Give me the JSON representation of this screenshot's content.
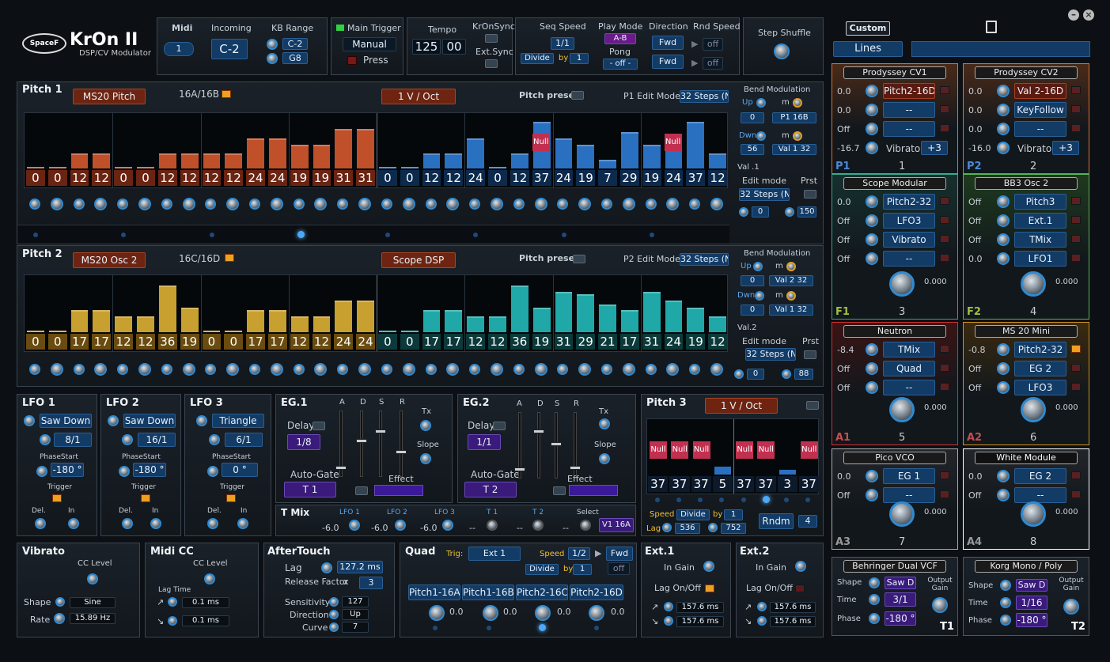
{
  "header": {
    "logo": "KrOn II",
    "logo_brand": "SpaceF",
    "subtitle": "DSP/CV Modulator",
    "midi_label": "Midi",
    "midi_value": "1",
    "incoming_label": "Incoming",
    "incoming_value": "C-2",
    "kb_range_label": "KB Range",
    "kb_low": "C-2",
    "kb_high": "G8",
    "main_trigger_label": "Main Trigger",
    "main_trigger_value": "Manual",
    "press_label": "Press",
    "tempo_label": "Tempo",
    "tempo_int": "125",
    "tempo_frac": "00",
    "kronsync_label": "KrOnSync",
    "extsync_label": "Ext.Sync",
    "seq_speed_label": "Seq Speed",
    "seq_speed_value": "1/1",
    "divide_label": "Divide",
    "by_label": "by",
    "by_value": "1",
    "play_mode_label": "Play Mode",
    "play_mode_value": "A-B",
    "pong_label": "Pong",
    "pong_value": "- off -",
    "direction_label": "Direction",
    "direction_value1": "Fwd",
    "direction_value2": "Fwd",
    "rnd_speed_label": "Rnd Speed",
    "rnd_value1": "off",
    "rnd_value2": "off",
    "step_shuffle_label": "Step Shuffle"
  },
  "pitch1": {
    "title": "Pitch 1",
    "source": "MS20 Pitch",
    "steps_label": "16A/16B",
    "mode": "1 V / Oct",
    "presets_label": "Pitch presets",
    "edit_mode_label": "P1 Edit Mode",
    "edit_mode_value": "32 Steps (N",
    "values": [
      "0",
      "0",
      "12",
      "12",
      "0",
      "0",
      "12",
      "12",
      "12",
      "12",
      "24",
      "24",
      "19",
      "19",
      "31",
      "31",
      "0",
      "0",
      "12",
      "12",
      "24",
      "0",
      "12",
      "37",
      "24",
      "19",
      "7",
      "29",
      "19",
      "24",
      "37",
      "12"
    ],
    "bend_label": "Bend Modulation",
    "up_label": "Up",
    "m_label": "m",
    "up_value": "0",
    "up_target": "P1 16B",
    "dwn_label": "Dwn",
    "dwn_value": "56",
    "dwn_target": "Val 1 32",
    "val_label": "Val .1",
    "edit_label": "Edit mode",
    "edit_value": "32 Steps (N",
    "prst_label": "Prst",
    "v_a": "0",
    "v_b": "150"
  },
  "pitch2": {
    "title": "Pitch 2",
    "source": "MS20 Osc 2",
    "steps_label": "16C/16D",
    "mode": "Scope DSP",
    "presets_label": "Pitch presets",
    "edit_mode_label": "P2 Edit Mode",
    "edit_mode_value": "32 Steps (N",
    "values": [
      "0",
      "0",
      "17",
      "17",
      "12",
      "12",
      "36",
      "19",
      "0",
      "0",
      "17",
      "17",
      "12",
      "12",
      "24",
      "24",
      "0",
      "0",
      "17",
      "17",
      "12",
      "12",
      "36",
      "19",
      "31",
      "29",
      "21",
      "17",
      "31",
      "24",
      "19",
      "12"
    ],
    "bend_label": "Bend Modulation",
    "up_label": "Up",
    "m_label": "m",
    "up_value": "0",
    "up_target": "Val 2 32",
    "dwn_label": "Dwn",
    "dwn_value": "0",
    "dwn_target": "Val 1 32",
    "val_label": "Val.2",
    "edit_label": "Edit mode",
    "edit_value": "32 Steps (N",
    "prst_label": "Prst",
    "v_a": "0",
    "v_b": "88"
  },
  "lfos": [
    {
      "title": "LFO 1",
      "wave": "Saw Down",
      "rate": "8/1",
      "phase_label": "PhaseStart",
      "phase": "-180 °",
      "trigger": "Trigger",
      "del": "Del.",
      "in": "In"
    },
    {
      "title": "LFO 2",
      "wave": "Saw Down",
      "rate": "16/1",
      "phase_label": "PhaseStart",
      "phase": "-180 °",
      "trigger": "Trigger",
      "del": "Del.",
      "in": "In"
    },
    {
      "title": "LFO 3",
      "wave": "Triangle",
      "rate": "6/1",
      "phase_label": "PhaseStart",
      "phase": "0 °",
      "trigger": "Trigger",
      "del": "Del.",
      "in": "In"
    }
  ],
  "egs": [
    {
      "title": "EG.1",
      "delay_label": "Delay",
      "delay": "1/8",
      "autogate": "Auto-Gate",
      "gate": "T 1",
      "effect": "Effect",
      "tx": "Tx",
      "slope": "Slope"
    },
    {
      "title": "EG.2",
      "delay_label": "Delay",
      "delay": "1/1",
      "autogate": "Auto-Gate",
      "gate": "T 2",
      "effect": "Effect",
      "tx": "Tx",
      "slope": "Slope"
    }
  ],
  "adsr": [
    "A",
    "D",
    "S",
    "R"
  ],
  "tmix": {
    "title": "T Mix",
    "labels": [
      "LFO 1",
      "LFO 2",
      "LFO 3",
      "T 1",
      "T 2",
      "Select"
    ],
    "values": [
      "-6.0",
      "-6.0",
      "-6.0",
      "--",
      "--",
      "--"
    ],
    "select": "V1 16A"
  },
  "pitch3": {
    "title": "Pitch 3",
    "mode": "1 V / Oct",
    "values": [
      "37",
      "37",
      "37",
      "5",
      "37",
      "37",
      "3",
      "37"
    ],
    "null": "Null",
    "speed_label": "Speed",
    "divide": "Divide",
    "by": "by",
    "by_value": "1",
    "lag_label": "Lag",
    "lag1": "536",
    "lag2": "752",
    "rndm": "Rndm",
    "rndm_value": "4"
  },
  "vibrato": {
    "title": "Vibrato",
    "cc_label": "CC Level",
    "shape_label": "Shape",
    "shape": "Sine",
    "rate_label": "Rate",
    "rate": "15.89 Hz"
  },
  "midicc": {
    "title": "Midi CC",
    "cc_label": "CC Level",
    "lag_label": "Lag Time",
    "lag1": "0.1 ms",
    "lag2": "0.1 ms"
  },
  "aftertouch": {
    "title": "AfterTouch",
    "lag_label": "Lag",
    "lag": "127.2 ms",
    "release_label": "Release Factor",
    "x_label": "x",
    "release": "3",
    "sens_label": "Sensitivity",
    "sens": "127",
    "dir_label": "Direction",
    "dir": "Up",
    "curve_label": "Curve",
    "curve": "7"
  },
  "quad": {
    "title": "Quad",
    "trig_label": "Trig:",
    "trig": "Ext 1",
    "speed_label": "Speed",
    "speed": "1/2",
    "dir": "Fwd",
    "divide": "Divide",
    "by": "by",
    "by_value": "1",
    "off": "off",
    "outs": [
      "Pitch1-16A",
      "Pitch1-16B",
      "Pitch2-16C",
      "Pitch2-16D"
    ],
    "vals": [
      "0.0",
      "0.0",
      "0.0",
      "0.0"
    ]
  },
  "ext1": {
    "title": "Ext.1",
    "gain": "In Gain",
    "lag": "Lag On/Off",
    "v1": "157.6 ms",
    "v2": "157.6 ms"
  },
  "ext2": {
    "title": "Ext.2",
    "gain": "In Gain",
    "lag": "Lag On/Off",
    "v1": "157.6 ms",
    "v2": "157.6 ms"
  },
  "right": {
    "custom": "Custom",
    "lines": "Lines"
  },
  "modules": [
    {
      "title": "Prodyssey CV1",
      "corner": "P1",
      "num": "1",
      "rows": [
        [
          "0.0",
          "Pitch2-16D"
        ],
        [
          "0.0",
          "--"
        ],
        [
          "Off",
          "--"
        ]
      ],
      "extra": [
        "-16.7",
        "Vibrato",
        "+3"
      ]
    },
    {
      "title": "Prodyssey CV2",
      "corner": "P2",
      "num": "2",
      "rows": [
        [
          "0.0",
          "Val 2-16D"
        ],
        [
          "0.0",
          "KeyFollow"
        ],
        [
          "0.0",
          "--"
        ]
      ],
      "extra": [
        "-16.0",
        "Vibrato",
        "+3"
      ]
    },
    {
      "title": "Scope Modular",
      "corner": "F1",
      "num": "3",
      "rows": [
        [
          "0.0",
          "Pitch2-32"
        ],
        [
          "Off",
          "LFO3"
        ],
        [
          "Off",
          "Vibrato"
        ],
        [
          "Off",
          "--"
        ]
      ],
      "knobval": "0.000"
    },
    {
      "title": "BB3 Osc 2",
      "corner": "F2",
      "num": "4",
      "rows": [
        [
          "Off",
          "Pitch3"
        ],
        [
          "Off",
          "Ext.1"
        ],
        [
          "Off",
          "TMix"
        ],
        [
          "0.0",
          "LFO1"
        ]
      ],
      "knobval": "0.000"
    },
    {
      "title": "Neutron",
      "corner": "A1",
      "num": "5",
      "rows": [
        [
          "-8.4",
          "TMix"
        ],
        [
          "Off",
          "Quad"
        ],
        [
          "Off",
          "--"
        ]
      ],
      "knobval": "0.000"
    },
    {
      "title": "MS 20 Mini",
      "corner": "A2",
      "num": "6",
      "rows": [
        [
          "-0.8",
          "Pitch2-32"
        ],
        [
          "Off",
          "EG 2"
        ],
        [
          "Off",
          "LFO3"
        ]
      ],
      "knobval": "0.000"
    },
    {
      "title": "Pico VCO",
      "corner": "A3",
      "num": "7",
      "rows": [
        [
          "0.0",
          "EG 1"
        ],
        [
          "Off",
          "--"
        ]
      ],
      "knobval": "0.000"
    },
    {
      "title": "White Module",
      "corner": "A4",
      "num": "8",
      "rows": [
        [
          "0.0",
          "EG 2"
        ],
        [
          "Off",
          "--"
        ]
      ],
      "knobval": "0.000"
    }
  ],
  "vcf": [
    {
      "title": "Behringer Dual VCF",
      "shape_label": "Shape",
      "shape": "Saw D",
      "time_label": "Time",
      "time": "3/1",
      "phase_label": "Phase",
      "phase": "-180 °",
      "out_label": "Output Gain",
      "corner": "T1"
    },
    {
      "title": "Korg Mono / Poly",
      "shape_label": "Shape",
      "shape": "Saw D",
      "time_label": "Time",
      "time": "1/16",
      "phase_label": "Phase",
      "phase": "-180 °",
      "out_label": "Output Gain",
      "corner": "T2"
    }
  ]
}
